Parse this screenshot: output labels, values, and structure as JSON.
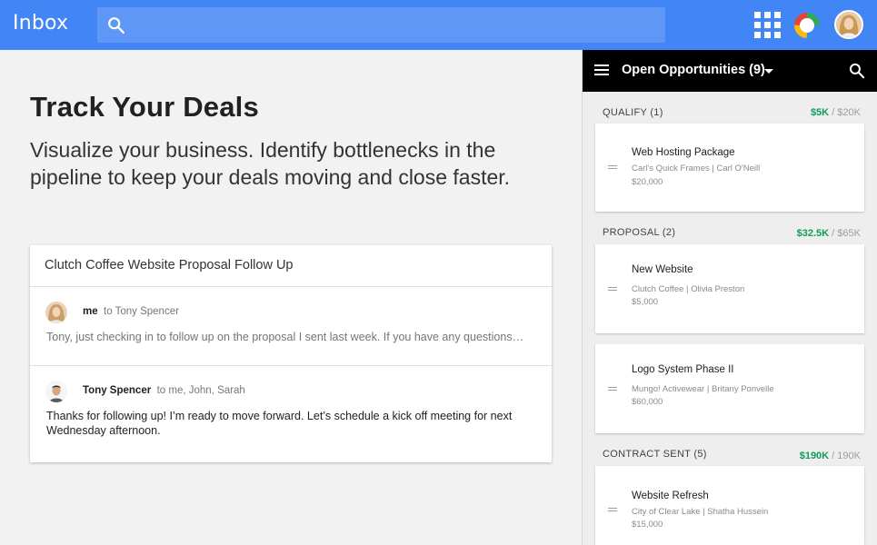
{
  "topbar": {
    "app_title": "Inbox",
    "search_placeholder": "",
    "colors": {
      "bar": "#4285f4",
      "search": "#5e97f6"
    }
  },
  "hero": {
    "title": "Track Your Deals",
    "subtitle": "Visualize your business. Identify bottlenecks in the pipeline to keep your deals moving and close faster."
  },
  "email": {
    "subject": "Clutch Coffee Website Proposal Follow Up",
    "messages": [
      {
        "sender": "me",
        "recipients": "to Tony Spencer",
        "snippet": "Tony, just checking in to follow up on the proposal I sent last week. If you have any questions…"
      },
      {
        "sender": "Tony Spencer",
        "recipients": "to me, John, Sarah",
        "body": "Thanks for following up! I’m ready to move forward. Let’s schedule a kick off meeting for next Wednesday afternoon."
      }
    ]
  },
  "panel": {
    "title": "Open Opportunities (9)",
    "colors": {
      "header": "#000000",
      "won_amount": "#0f9d58"
    },
    "stages": [
      {
        "label": "QUALIFY (1)",
        "won": "$5K",
        "separator": " / ",
        "total": "$20K",
        "deals": [
          {
            "name": "Web Hosting Package",
            "org": "Carl's Quick Frames | Carl O'Neill",
            "value": "$20,000"
          }
        ]
      },
      {
        "label": "PROPOSAL (2)",
        "won": "$32.5K",
        "separator": " / ",
        "total": "$65K",
        "deals": [
          {
            "name": "New Website",
            "org": "Clutch Coffee | Olivia Preston",
            "value": "$5,000"
          },
          {
            "name": "Logo System Phase II",
            "org": "Mungo! Activewear | Britany Ponvelle",
            "value": "$60,000"
          }
        ]
      },
      {
        "label": "CONTRACT SENT (5)",
        "won": "$190K",
        "separator": " / ",
        "total": "190K",
        "deals": [
          {
            "name": "Website Refresh",
            "org": "City of Clear Lake | Shatha Hussein",
            "value": "$15,000"
          }
        ]
      }
    ]
  }
}
